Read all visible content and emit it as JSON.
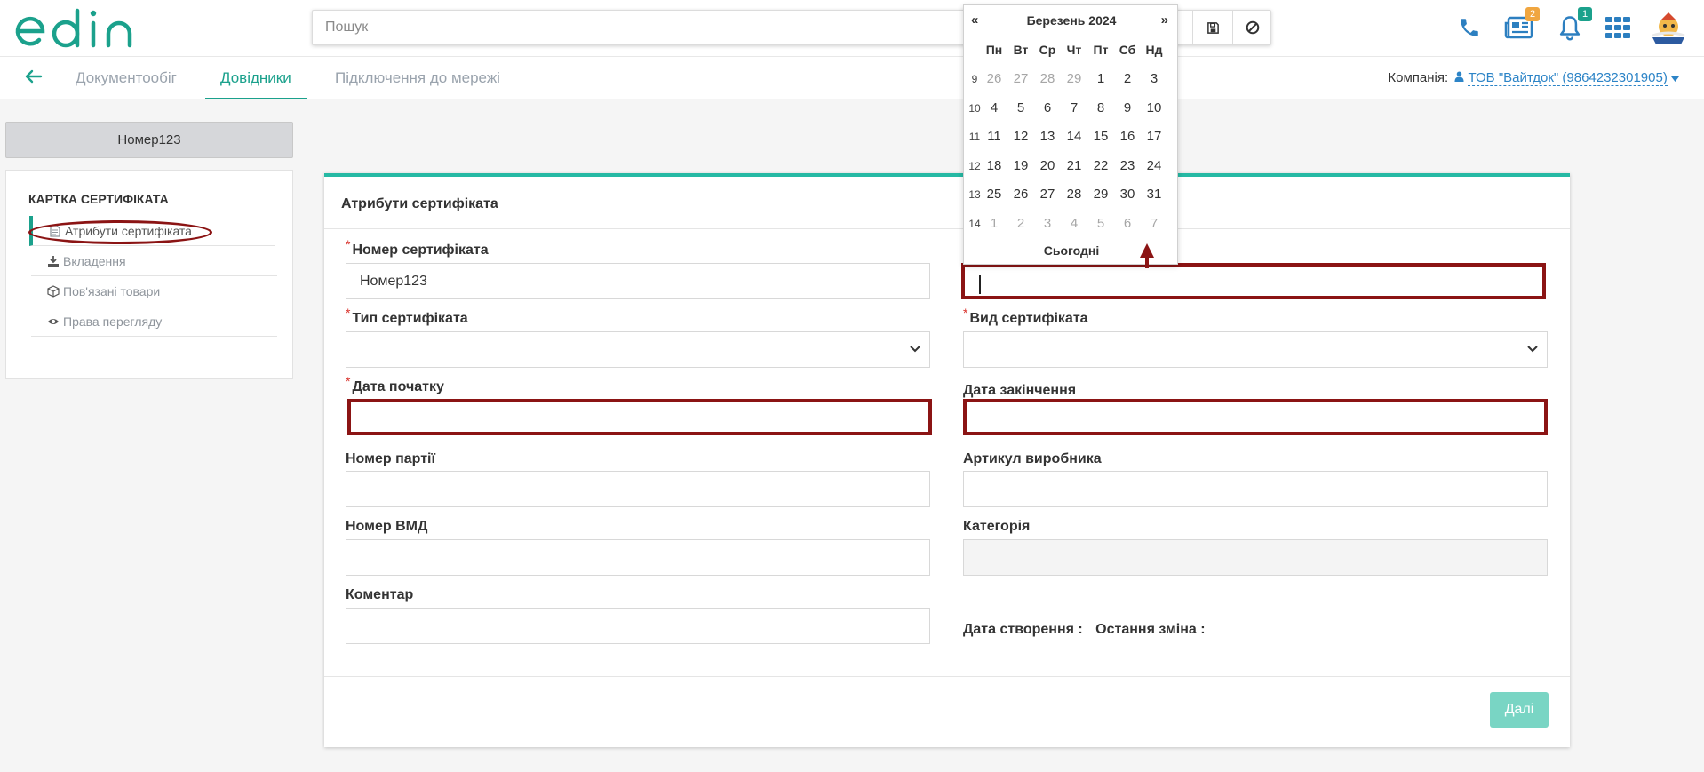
{
  "header": {
    "search_placeholder": "Пошук",
    "notifications_badge": "1",
    "news_badge": "2",
    "brand_color": "#1ba18c",
    "icons": [
      "phone-icon",
      "newspaper-icon",
      "bell-icon",
      "apps-grid-icon",
      "save-icon",
      "clear-icon"
    ]
  },
  "subnav": {
    "tabs": [
      {
        "label": "Документообіг",
        "active": false
      },
      {
        "label": "Довідники",
        "active": true
      },
      {
        "label": "Підключення до мережі",
        "active": false
      }
    ],
    "company_label": "Компанія:",
    "company_value": "ТОВ \"Вайтдок\" (9864232301905)"
  },
  "sidebar": {
    "doc_name": "Номер123",
    "section_title": "КАРТКА СЕРТИФІКАТА",
    "items": [
      {
        "label": "Атрибути сертифіката",
        "icon": "document-icon",
        "active": true
      },
      {
        "label": "Вкладення",
        "icon": "download-icon",
        "active": false
      },
      {
        "label": "Пов'язані товари",
        "icon": "box-icon",
        "active": false
      },
      {
        "label": "Права перегляду",
        "icon": "eye-icon",
        "active": false
      }
    ]
  },
  "form": {
    "title": "Атрибути сертифіката",
    "fields": {
      "cert_number": {
        "label": "Номер сертифіката",
        "value": "Номер123",
        "required": true
      },
      "cert_type": {
        "label": "Тип сертифіката",
        "value": "",
        "required": true
      },
      "cert_kind": {
        "label": "Вид сертифіката",
        "value": "",
        "required": true
      },
      "start_date": {
        "label": "Дата початку",
        "value": "",
        "required": true
      },
      "end_date": {
        "label": "Дата закінчення",
        "value": "",
        "required": false
      },
      "batch_number": {
        "label": "Номер партії",
        "value": ""
      },
      "manufacturer_sku": {
        "label": "Артикул виробника",
        "value": ""
      },
      "vmd_number": {
        "label": "Номер ВМД",
        "value": ""
      },
      "category": {
        "label": "Категорія",
        "value": ""
      },
      "comment": {
        "label": "Коментар",
        "value": ""
      }
    },
    "created_label": "Дата створення :",
    "modified_label": "Остання зміна :",
    "next_button": "Далі",
    "required_mark": "*"
  },
  "datepicker": {
    "prev": "«",
    "next": "»",
    "month": "Березень 2024",
    "weekdays": [
      "Пн",
      "Вт",
      "Ср",
      "Чт",
      "Пт",
      "Сб",
      "Нд"
    ],
    "weeks": [
      {
        "num": "9",
        "days": [
          "26",
          "27",
          "28",
          "29",
          "1",
          "2",
          "3"
        ],
        "muted": [
          true,
          true,
          true,
          true,
          false,
          false,
          false
        ]
      },
      {
        "num": "10",
        "days": [
          "4",
          "5",
          "6",
          "7",
          "8",
          "9",
          "10"
        ],
        "muted": [
          false,
          false,
          false,
          false,
          false,
          false,
          false
        ]
      },
      {
        "num": "11",
        "days": [
          "11",
          "12",
          "13",
          "14",
          "15",
          "16",
          "17"
        ],
        "muted": [
          false,
          false,
          false,
          false,
          false,
          false,
          false
        ]
      },
      {
        "num": "12",
        "days": [
          "18",
          "19",
          "20",
          "21",
          "22",
          "23",
          "24"
        ],
        "muted": [
          false,
          false,
          false,
          false,
          false,
          false,
          false
        ]
      },
      {
        "num": "13",
        "days": [
          "25",
          "26",
          "27",
          "28",
          "29",
          "30",
          "31"
        ],
        "muted": [
          false,
          false,
          false,
          false,
          false,
          false,
          false
        ]
      },
      {
        "num": "14",
        "days": [
          "1",
          "2",
          "3",
          "4",
          "5",
          "6",
          "7"
        ],
        "muted": [
          true,
          true,
          true,
          true,
          true,
          true,
          true
        ]
      }
    ],
    "today": "Сьогодні"
  }
}
